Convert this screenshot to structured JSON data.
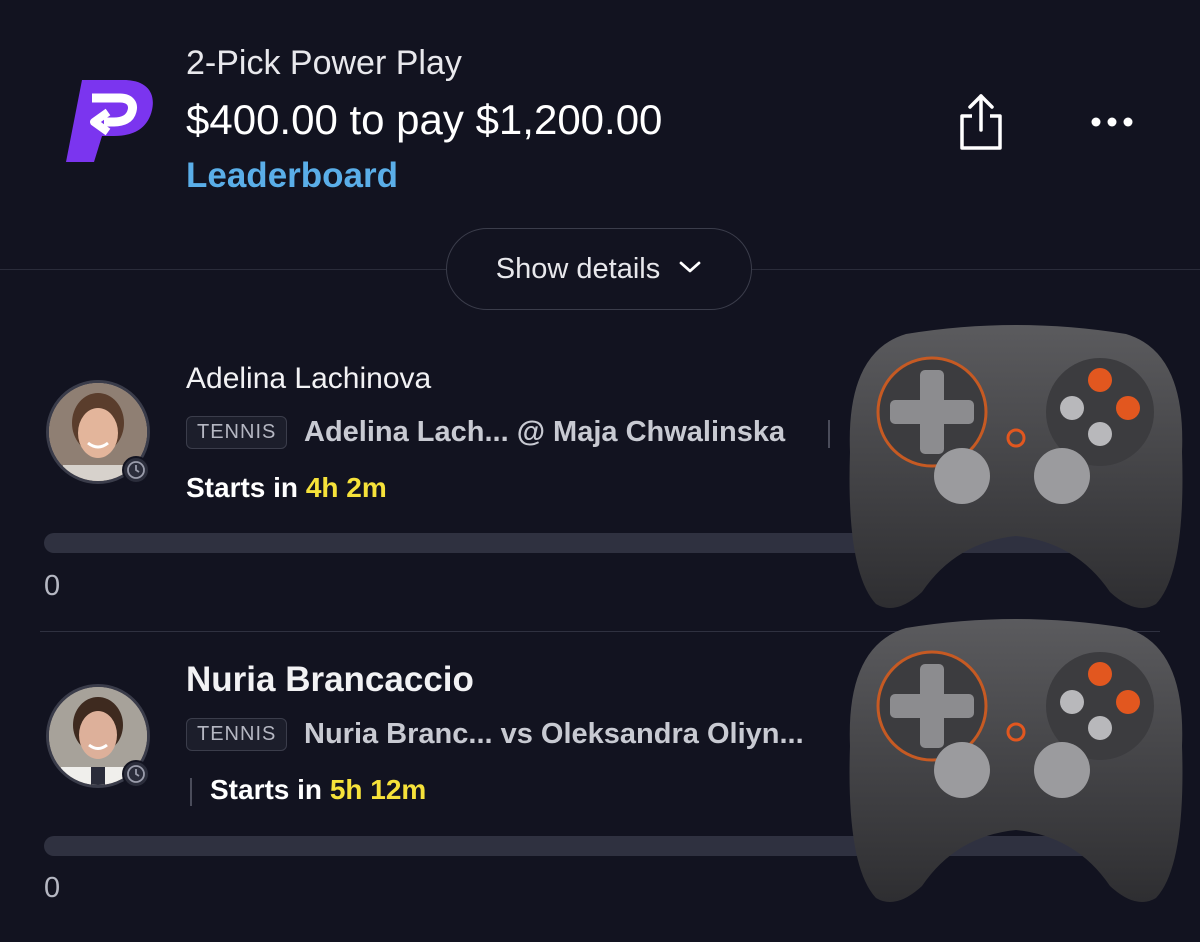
{
  "header": {
    "entry_type": "2-Pick Power Play",
    "payout": "$400.00 to pay $1,200.00",
    "leaderboard": "Leaderboard"
  },
  "show_details": {
    "label": "Show details"
  },
  "picks": [
    {
      "player_name": "Adelina Lachinova",
      "sport": "TENNIS",
      "matchup": "Adelina Lach... @ Maja Chwalinska",
      "starts_prefix": "Starts in ",
      "starts_time": "4h 2m",
      "score": "0"
    },
    {
      "player_name": "Nuria Brancaccio",
      "sport": "TENNIS",
      "matchup": "Nuria Branc...  vs Oleksandra Oliyn...",
      "starts_prefix": "Starts in ",
      "starts_time": "5h 12m",
      "score": "0"
    }
  ],
  "colors": {
    "background": "#121320",
    "brand_purple": "#7b35ef",
    "link_blue": "#5aaee8",
    "time_yellow": "#f6e23a",
    "accent_orange": "#e2571f"
  },
  "icons": {
    "logo": "prizepicks-logo",
    "share": "share-icon",
    "more": "more-icon",
    "chevron": "chevron-down-icon",
    "clock": "clock-icon",
    "overlay": "game-controller-icon"
  }
}
